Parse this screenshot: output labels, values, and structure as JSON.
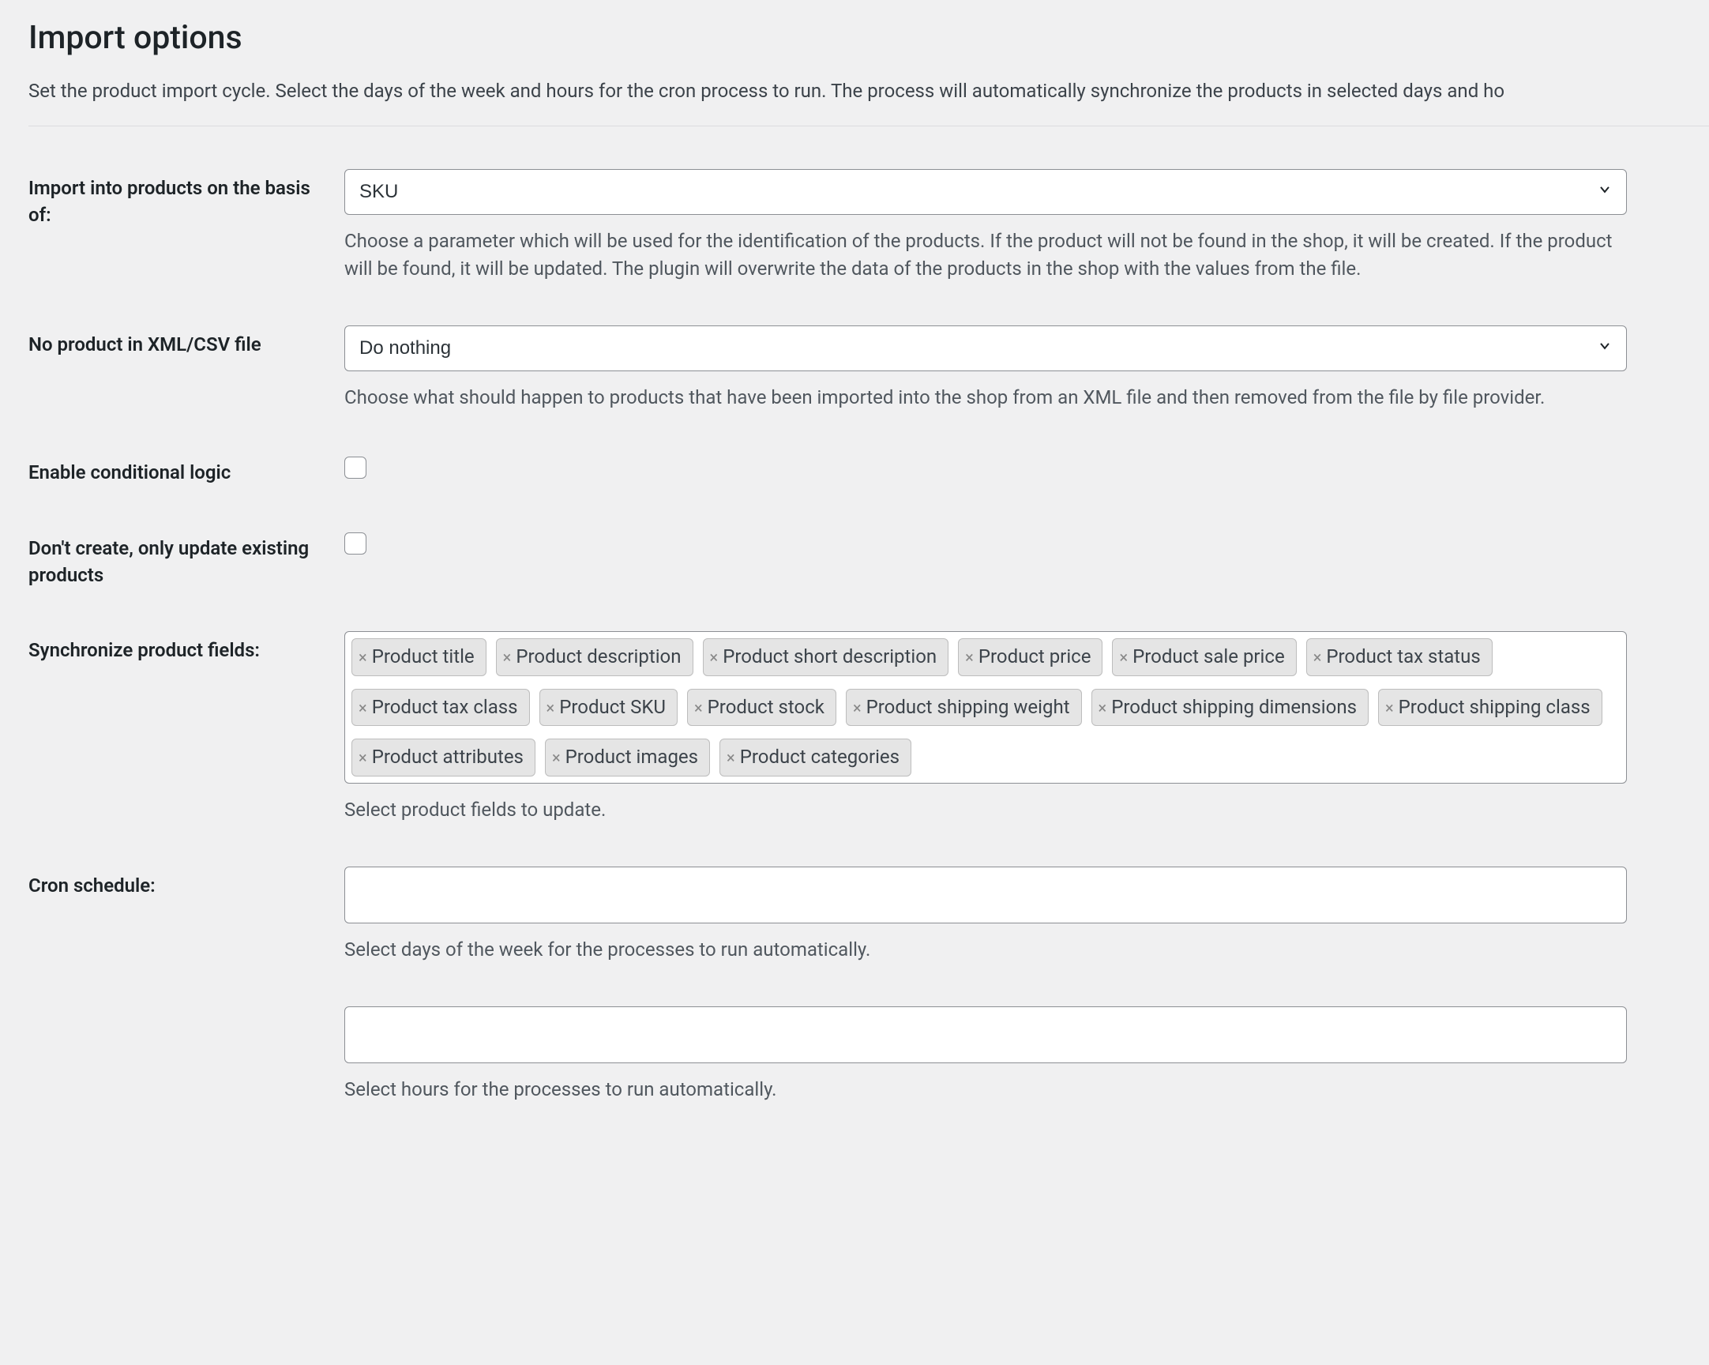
{
  "title": "Import options",
  "intro": "Set the product import cycle. Select the days of the week and hours for the cron process to run. The process will automatically synchronize the products in selected days and ho",
  "rows": {
    "basis": {
      "label": "Import into products on the basis of:",
      "value": "SKU",
      "help": "Choose a parameter which will be used for the identification of the products. If the product will not be found in the shop, it will be created. If the product will be found, it will be updated. The plugin will overwrite the data of the products in the shop with the values from the file."
    },
    "no_product": {
      "label": "No product in XML/CSV file",
      "value": "Do nothing",
      "help": "Choose what should happen to products that have been imported into the shop from an XML file and then removed from the file by file provider."
    },
    "conditional": {
      "label": "Enable conditional logic"
    },
    "only_update": {
      "label": "Don't create, only update existing products"
    },
    "sync_fields": {
      "label": "Synchronize product fields:",
      "help": "Select product fields to update.",
      "tags": [
        "Product title",
        "Product description",
        "Product short description",
        "Product price",
        "Product sale price",
        "Product tax status",
        "Product tax class",
        "Product SKU",
        "Product stock",
        "Product shipping weight",
        "Product shipping dimensions",
        "Product shipping class",
        "Product attributes",
        "Product images",
        "Product categories"
      ]
    },
    "cron_days": {
      "label": "Cron schedule:",
      "help": "Select days of the week for the processes to run automatically."
    },
    "cron_hours": {
      "help": "Select hours for the processes to run automatically."
    }
  }
}
